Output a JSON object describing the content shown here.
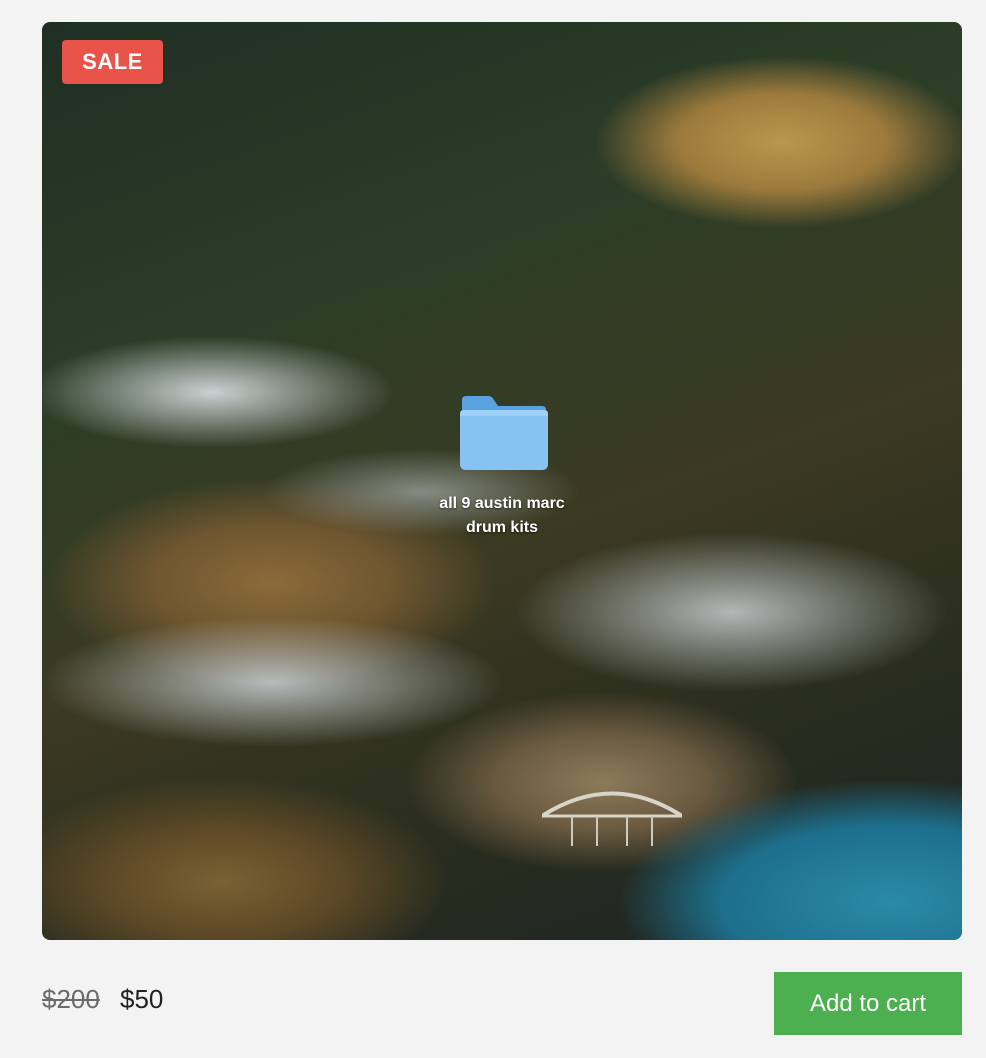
{
  "badge": {
    "label": "SALE",
    "color": "#e8534a"
  },
  "image": {
    "folder_label_line1": "all 9 austin marc",
    "folder_label_line2": "drum kits",
    "folder_icon": "folder-icon"
  },
  "pricing": {
    "original_price": "$200",
    "sale_price": "$50"
  },
  "cart": {
    "button_label": "Add to cart",
    "button_color": "#4caf50"
  }
}
